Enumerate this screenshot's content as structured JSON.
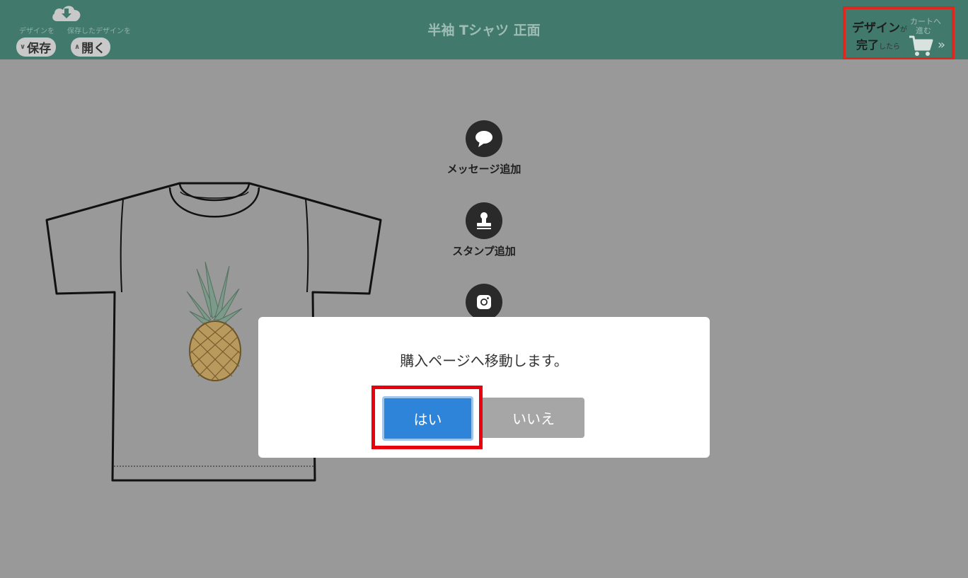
{
  "header": {
    "title": "半袖 Tシャツ 正面",
    "save": {
      "caption": "デザインを",
      "label": "保存",
      "icon": "cloud-download-icon"
    },
    "open": {
      "caption": "保存したデザインを",
      "label": "開く"
    },
    "cart": {
      "line1": "デザイン",
      "line1_small": "が",
      "line2": "完了",
      "line2_small": "したら",
      "caption1": "カートへ",
      "caption2": "進む",
      "icon": "cart-icon"
    }
  },
  "tools": [
    {
      "label": "メッセージ追加",
      "icon": "speech-bubble-icon"
    },
    {
      "label": "スタンプ追加",
      "icon": "stamp-icon"
    },
    {
      "label": "",
      "icon": "instagram-icon"
    }
  ],
  "modal": {
    "message": "購入ページへ移動します。",
    "yes_label": "はい",
    "no_label": "いいえ"
  },
  "colors": {
    "header_bg": "#417a6c",
    "overlay_bg": "#999999",
    "highlight": "#e8000f",
    "primary": "#2e84d8",
    "secondary": "#a6a6a6"
  }
}
